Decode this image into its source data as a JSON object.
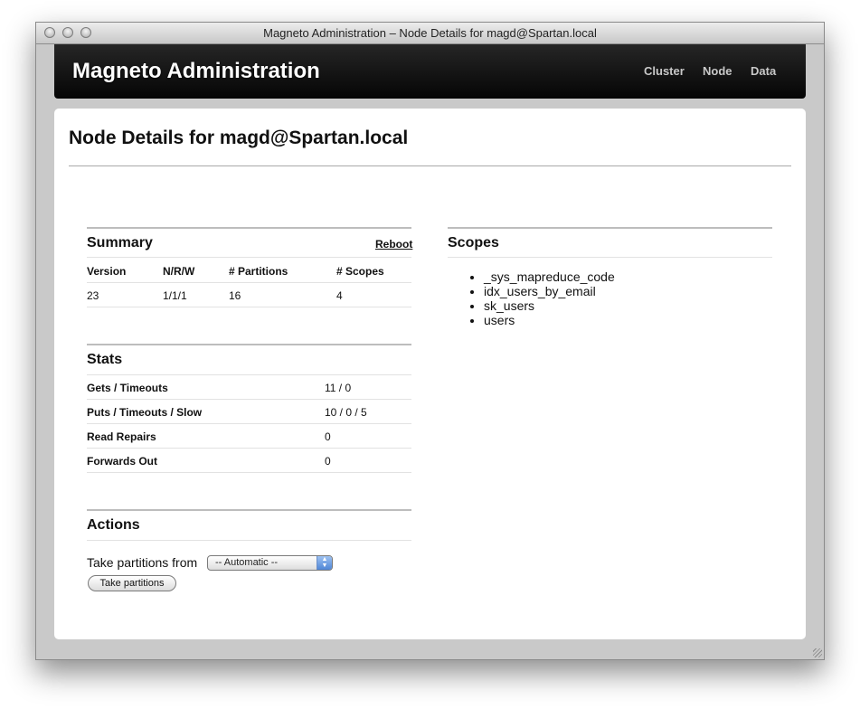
{
  "window": {
    "title": "Magneto Administration – Node Details for magd@Spartan.local"
  },
  "header": {
    "brand": "Magneto Administration",
    "nav": [
      "Cluster",
      "Node",
      "Data"
    ]
  },
  "page": {
    "title": "Node Details for magd@Spartan.local"
  },
  "summary": {
    "heading": "Summary",
    "reboot_label": "Reboot",
    "columns": [
      "Version",
      "N/R/W",
      "# Partitions",
      "# Scopes"
    ],
    "row": [
      "23",
      "1/1/1",
      "16",
      "4"
    ]
  },
  "stats": {
    "heading": "Stats",
    "rows": [
      {
        "label": "Gets / Timeouts",
        "value": "11 / 0"
      },
      {
        "label": "Puts / Timeouts / Slow",
        "value": "10 / 0 / 5"
      },
      {
        "label": "Read Repairs",
        "value": "0"
      },
      {
        "label": "Forwards Out",
        "value": "0"
      }
    ]
  },
  "actions": {
    "heading": "Actions",
    "take_label": "Take partitions from",
    "select_value": "-- Automatic --",
    "button_label": "Take partitions"
  },
  "scopes": {
    "heading": "Scopes",
    "items": [
      "_sys_mapreduce_code",
      "idx_users_by_email",
      "sk_users",
      "users"
    ]
  }
}
